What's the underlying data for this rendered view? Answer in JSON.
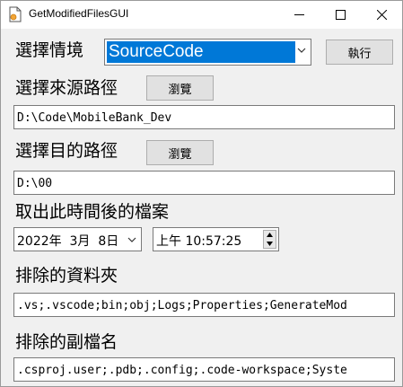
{
  "window": {
    "title": "GetModifiedFilesGUI",
    "icons": {
      "app": "file-icon",
      "minimize": "minimize-icon",
      "maximize": "maximize-icon",
      "close": "close-icon"
    }
  },
  "scenario": {
    "label": "選擇情境",
    "selected": "SourceCode",
    "run_label": "執行"
  },
  "source": {
    "label": "選擇來源路徑",
    "browse_label": "瀏覽",
    "value": "D:\\Code\\MobileBank_Dev"
  },
  "target": {
    "label": "選擇目的路徑",
    "browse_label": "瀏覽",
    "value": "D:\\00"
  },
  "since": {
    "label": "取出此時間後的檔案",
    "date": "2022年  3月  8日",
    "time": "上午 10:57:25"
  },
  "exclude_folders": {
    "label": "排除的資料夾",
    "value": ".vs;.vscode;bin;obj;Logs;Properties;GenerateMod"
  },
  "exclude_ext": {
    "label": "排除的副檔名",
    "value": ".csproj.user;.pdb;.config;.code-workspace;Syste"
  }
}
